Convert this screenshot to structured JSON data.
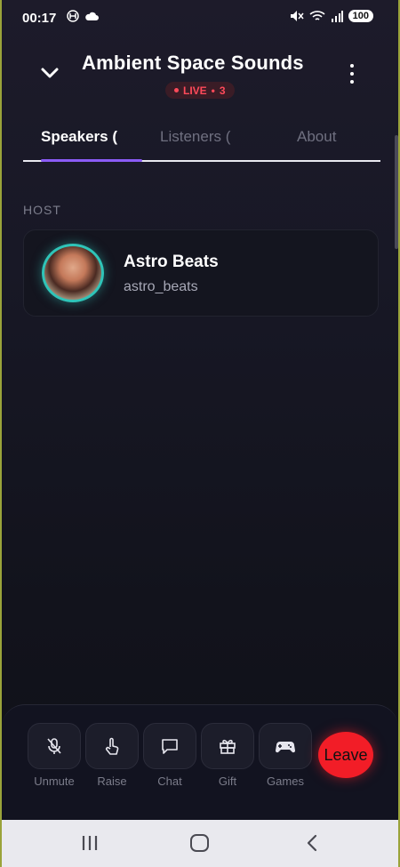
{
  "status_bar": {
    "time": "00:17",
    "battery": "100"
  },
  "header": {
    "title": "Ambient Space Sounds",
    "live_label": "LIVE",
    "live_count": "3"
  },
  "tabs": [
    {
      "label": "Speakers ("
    },
    {
      "label": "Listeners ("
    },
    {
      "label": "About"
    }
  ],
  "host_section": {
    "heading": "HOST",
    "host": {
      "name": "Astro Beats",
      "username": "astro_beats"
    }
  },
  "controls": {
    "unmute": "Unmute",
    "raise": "Raise",
    "chat": "Chat",
    "gift": "Gift",
    "games": "Games",
    "leave": "Leave"
  },
  "colors": {
    "accent": "#8b5cf6",
    "live": "#ff4a5a",
    "leave": "#f21d27",
    "avatar_ring": "#2fc4b8"
  }
}
